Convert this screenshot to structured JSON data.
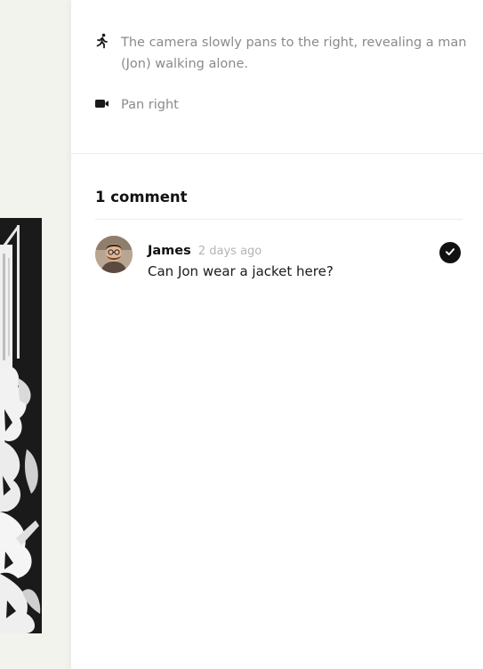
{
  "shot": {
    "action_icon": "walking-person-icon",
    "action_text": "The camera slowly pans to the right, revealing a man (Jon) walking alone.",
    "camera_icon": "video-camera-icon",
    "camera_text": "Pan right"
  },
  "comments": {
    "title": "1 comment",
    "items": [
      {
        "author": "James",
        "time": "2 days ago",
        "body": "Can Jon wear a jacket here?",
        "resolved": true,
        "avatar_icon": "user-avatar"
      }
    ]
  },
  "colors": {
    "panel_background": "#ffffff",
    "canvas_background": "#f3f3ee",
    "muted_text": "#8a8a8a",
    "resolve_button": "#111111"
  }
}
